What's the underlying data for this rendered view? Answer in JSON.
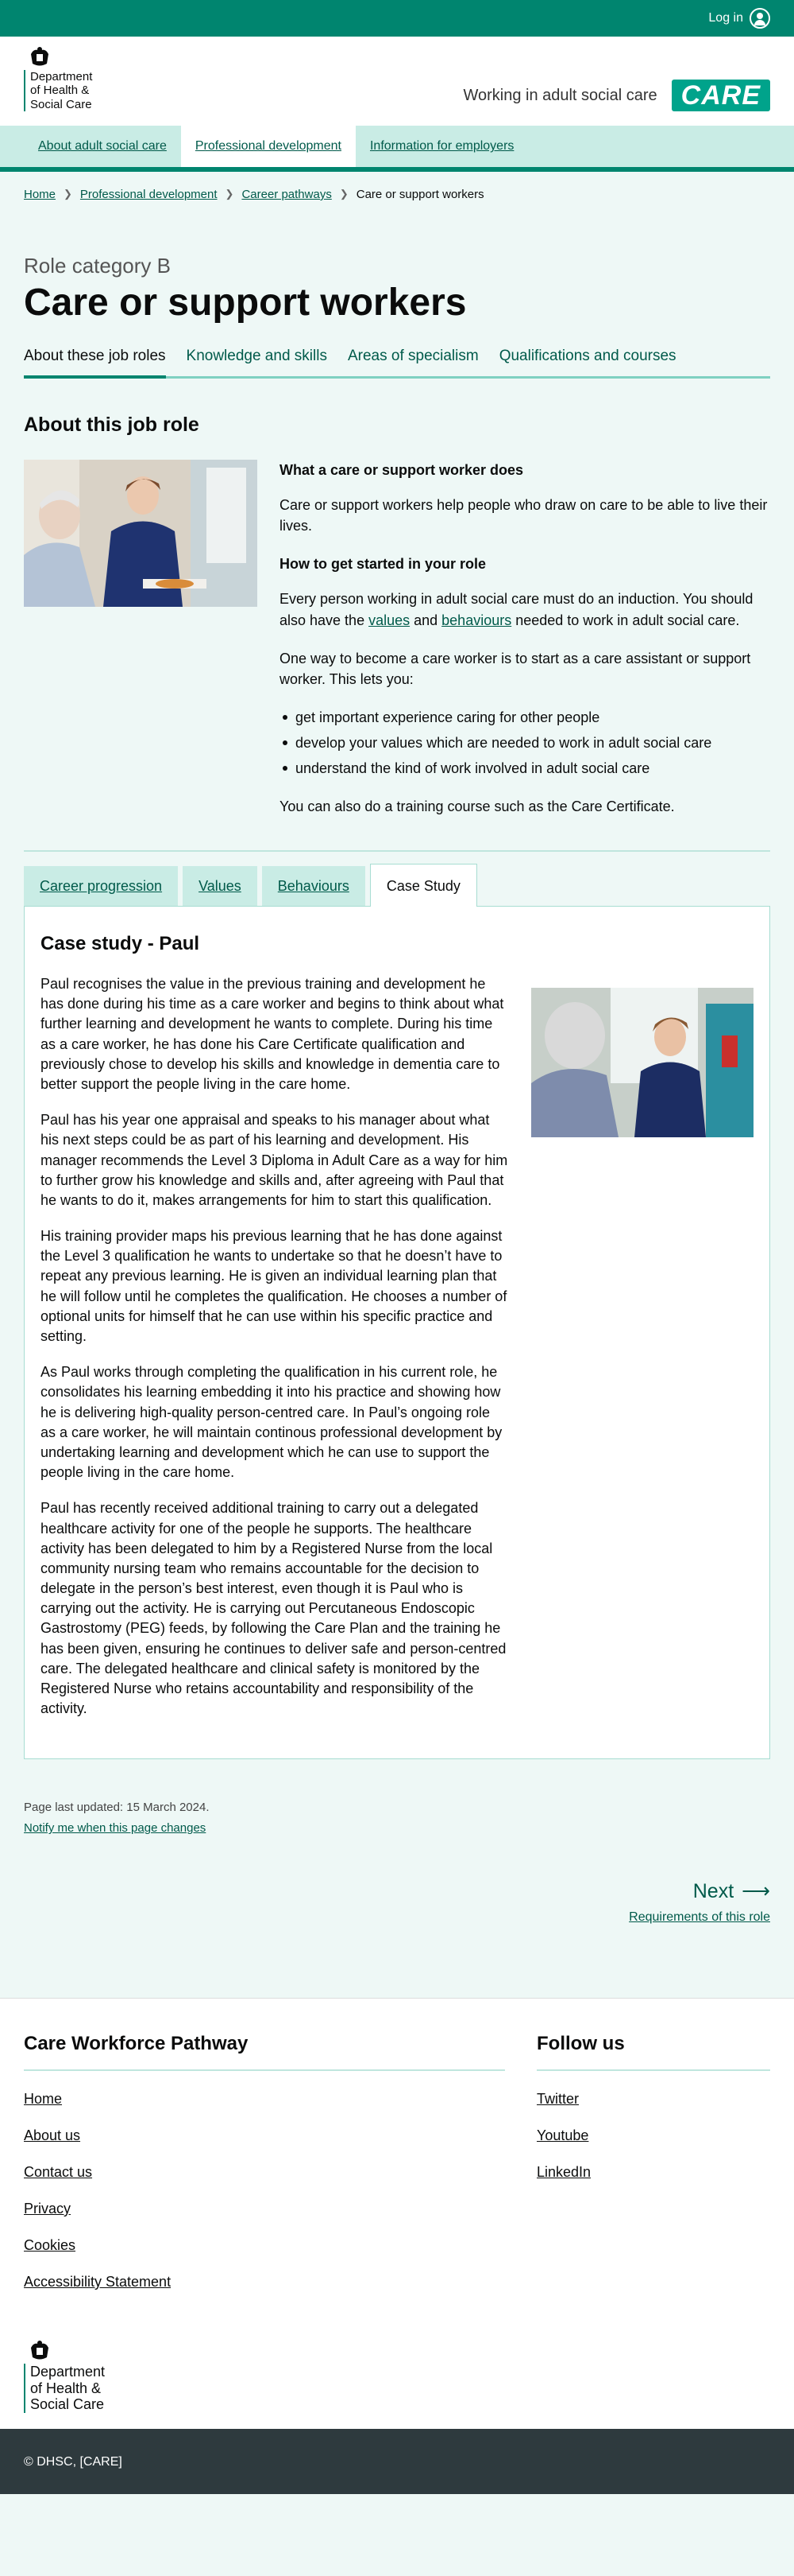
{
  "topbar": {
    "login_label": "Log in"
  },
  "header": {
    "org_name_lines": [
      "Department",
      "of Health &",
      "Social Care"
    ],
    "tagline": "Working in adult social care",
    "brand_logo": "CARE"
  },
  "nav": [
    {
      "label": "About adult social care",
      "active": false
    },
    {
      "label": "Professional development",
      "active": true
    },
    {
      "label": "Information for employers",
      "active": false
    }
  ],
  "breadcrumb": {
    "items": [
      "Home",
      "Professional development",
      "Career pathways"
    ],
    "current": "Care or support workers"
  },
  "page": {
    "caption": "Role category B",
    "title": "Care or support workers"
  },
  "subtabs": [
    {
      "label": "About these job roles",
      "active": true
    },
    {
      "label": "Knowledge and skills",
      "active": false
    },
    {
      "label": "Areas of specialism",
      "active": false
    },
    {
      "label": "Qualifications and courses",
      "active": false
    }
  ],
  "about": {
    "heading": "About this job role",
    "what_heading": "What a care or support worker does",
    "what_text": "Care or support workers help people who draw on care to be able to live their lives.",
    "how_heading": "How to get started in your role",
    "how_text_1a": "Every person working in adult social care must do an induction. You should also have the ",
    "how_link_values": "values",
    "how_text_1b": " and ",
    "how_link_behaviours": "behaviours",
    "how_text_1c": " needed to work in adult social care.",
    "how_text_2": "One way to become a care worker is to start as a care assistant or support worker. This lets you:",
    "bullets": [
      "get important experience caring for other people",
      "develop your values which are needed to work in adult social care",
      "understand the kind of work involved in adult social care"
    ],
    "how_text_3": "You can also do a training course such as the Care Certificate."
  },
  "tabs": [
    {
      "label": "Career progression",
      "active": false
    },
    {
      "label": "Values",
      "active": false
    },
    {
      "label": "Behaviours",
      "active": false
    },
    {
      "label": "Case Study",
      "active": true
    }
  ],
  "case_study": {
    "heading": "Case study - Paul",
    "paragraphs": [
      "Paul recognises the value in the previous training and development he has done during his time as a care worker and begins to think about what further learning and development he wants to complete. During his time as a care worker, he has done his Care Certificate qualification and previously chose to develop his skills and knowledge in dementia care to better support the people living in the care home.",
      "Paul has his year one appraisal and speaks to his manager about what his next steps could be as part of his learning and development. His manager recommends the Level 3 Diploma in Adult Care as a way for him to further grow his knowledge and skills and, after agreeing with Paul that he wants to do it, makes arrangements for him to start this qualification.",
      "His training provider maps his previous learning that he has done against the Level 3 qualification he wants to undertake so that he doesn’t have to repeat any previous learning. He is given an individual learning plan that he will follow until he completes the qualification. He chooses a number of optional units for himself that he can use within his specific practice and setting.",
      "As Paul works through completing the qualification in his current role, he consolidates his learning embedding it into his practice and showing how he is delivering high-quality person-centred care. In Paul’s ongoing role as a care worker, he will maintain continous professional development by undertaking learning and development which he can use to support the people living in the care home.",
      "Paul has recently received additional training to carry out a delegated healthcare activity for one of the people he supports. The healthcare activity has been delegated to him by a Registered Nurse from the local community nursing team who remains accountable for the decision to delegate in the person’s best interest, even though it is Paul who is carrying out the activity. He is carrying out Percutaneous Endoscopic Gastrostomy (PEG) feeds, by following the Care Plan and the training he has been given, ensuring he continues to deliver safe and person-centred care. The delegated healthcare and clinical safety is monitored by the Registered Nurse who retains accountability and responsibility of the activity."
    ]
  },
  "meta": {
    "updated": "Page last updated: 15 March 2024.",
    "notify": "Notify me when this page changes"
  },
  "next": {
    "label": "Next",
    "sub": "Requirements of this role"
  },
  "footer": {
    "col1_heading": "Care Workforce Pathway",
    "col1_links": [
      "Home",
      "About us",
      "Contact us",
      "Privacy",
      "Cookies",
      "Accessibility Statement"
    ],
    "col2_heading": "Follow us",
    "col2_links": [
      "Twitter",
      "Youtube",
      "LinkedIn"
    ],
    "copyright": "© DHSC, [CARE]"
  },
  "colors": {
    "primary": "#00856f",
    "nav_bg": "#c9ece5",
    "page_bg": "#eef8f6",
    "footer_dark": "#2e3a3e"
  }
}
